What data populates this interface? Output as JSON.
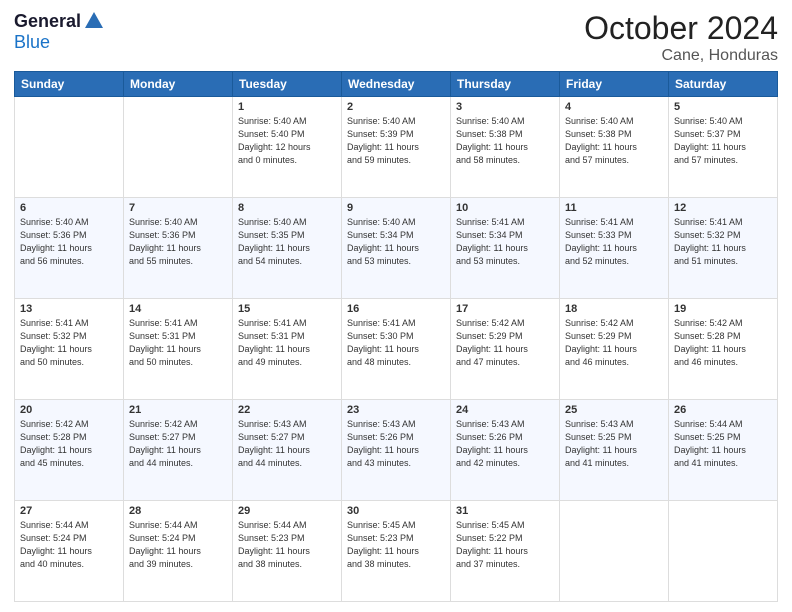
{
  "header": {
    "logo": {
      "general": "General",
      "blue": "Blue"
    },
    "title": "October 2024",
    "subtitle": "Cane, Honduras"
  },
  "weekdays": [
    "Sunday",
    "Monday",
    "Tuesday",
    "Wednesday",
    "Thursday",
    "Friday",
    "Saturday"
  ],
  "weeks": [
    [
      {
        "day": "",
        "info": ""
      },
      {
        "day": "",
        "info": ""
      },
      {
        "day": "1",
        "info": "Sunrise: 5:40 AM\nSunset: 5:40 PM\nDaylight: 12 hours\nand 0 minutes."
      },
      {
        "day": "2",
        "info": "Sunrise: 5:40 AM\nSunset: 5:39 PM\nDaylight: 11 hours\nand 59 minutes."
      },
      {
        "day": "3",
        "info": "Sunrise: 5:40 AM\nSunset: 5:38 PM\nDaylight: 11 hours\nand 58 minutes."
      },
      {
        "day": "4",
        "info": "Sunrise: 5:40 AM\nSunset: 5:38 PM\nDaylight: 11 hours\nand 57 minutes."
      },
      {
        "day": "5",
        "info": "Sunrise: 5:40 AM\nSunset: 5:37 PM\nDaylight: 11 hours\nand 57 minutes."
      }
    ],
    [
      {
        "day": "6",
        "info": "Sunrise: 5:40 AM\nSunset: 5:36 PM\nDaylight: 11 hours\nand 56 minutes."
      },
      {
        "day": "7",
        "info": "Sunrise: 5:40 AM\nSunset: 5:36 PM\nDaylight: 11 hours\nand 55 minutes."
      },
      {
        "day": "8",
        "info": "Sunrise: 5:40 AM\nSunset: 5:35 PM\nDaylight: 11 hours\nand 54 minutes."
      },
      {
        "day": "9",
        "info": "Sunrise: 5:40 AM\nSunset: 5:34 PM\nDaylight: 11 hours\nand 53 minutes."
      },
      {
        "day": "10",
        "info": "Sunrise: 5:41 AM\nSunset: 5:34 PM\nDaylight: 11 hours\nand 53 minutes."
      },
      {
        "day": "11",
        "info": "Sunrise: 5:41 AM\nSunset: 5:33 PM\nDaylight: 11 hours\nand 52 minutes."
      },
      {
        "day": "12",
        "info": "Sunrise: 5:41 AM\nSunset: 5:32 PM\nDaylight: 11 hours\nand 51 minutes."
      }
    ],
    [
      {
        "day": "13",
        "info": "Sunrise: 5:41 AM\nSunset: 5:32 PM\nDaylight: 11 hours\nand 50 minutes."
      },
      {
        "day": "14",
        "info": "Sunrise: 5:41 AM\nSunset: 5:31 PM\nDaylight: 11 hours\nand 50 minutes."
      },
      {
        "day": "15",
        "info": "Sunrise: 5:41 AM\nSunset: 5:31 PM\nDaylight: 11 hours\nand 49 minutes."
      },
      {
        "day": "16",
        "info": "Sunrise: 5:41 AM\nSunset: 5:30 PM\nDaylight: 11 hours\nand 48 minutes."
      },
      {
        "day": "17",
        "info": "Sunrise: 5:42 AM\nSunset: 5:29 PM\nDaylight: 11 hours\nand 47 minutes."
      },
      {
        "day": "18",
        "info": "Sunrise: 5:42 AM\nSunset: 5:29 PM\nDaylight: 11 hours\nand 46 minutes."
      },
      {
        "day": "19",
        "info": "Sunrise: 5:42 AM\nSunset: 5:28 PM\nDaylight: 11 hours\nand 46 minutes."
      }
    ],
    [
      {
        "day": "20",
        "info": "Sunrise: 5:42 AM\nSunset: 5:28 PM\nDaylight: 11 hours\nand 45 minutes."
      },
      {
        "day": "21",
        "info": "Sunrise: 5:42 AM\nSunset: 5:27 PM\nDaylight: 11 hours\nand 44 minutes."
      },
      {
        "day": "22",
        "info": "Sunrise: 5:43 AM\nSunset: 5:27 PM\nDaylight: 11 hours\nand 44 minutes."
      },
      {
        "day": "23",
        "info": "Sunrise: 5:43 AM\nSunset: 5:26 PM\nDaylight: 11 hours\nand 43 minutes."
      },
      {
        "day": "24",
        "info": "Sunrise: 5:43 AM\nSunset: 5:26 PM\nDaylight: 11 hours\nand 42 minutes."
      },
      {
        "day": "25",
        "info": "Sunrise: 5:43 AM\nSunset: 5:25 PM\nDaylight: 11 hours\nand 41 minutes."
      },
      {
        "day": "26",
        "info": "Sunrise: 5:44 AM\nSunset: 5:25 PM\nDaylight: 11 hours\nand 41 minutes."
      }
    ],
    [
      {
        "day": "27",
        "info": "Sunrise: 5:44 AM\nSunset: 5:24 PM\nDaylight: 11 hours\nand 40 minutes."
      },
      {
        "day": "28",
        "info": "Sunrise: 5:44 AM\nSunset: 5:24 PM\nDaylight: 11 hours\nand 39 minutes."
      },
      {
        "day": "29",
        "info": "Sunrise: 5:44 AM\nSunset: 5:23 PM\nDaylight: 11 hours\nand 38 minutes."
      },
      {
        "day": "30",
        "info": "Sunrise: 5:45 AM\nSunset: 5:23 PM\nDaylight: 11 hours\nand 38 minutes."
      },
      {
        "day": "31",
        "info": "Sunrise: 5:45 AM\nSunset: 5:22 PM\nDaylight: 11 hours\nand 37 minutes."
      },
      {
        "day": "",
        "info": ""
      },
      {
        "day": "",
        "info": ""
      }
    ]
  ]
}
